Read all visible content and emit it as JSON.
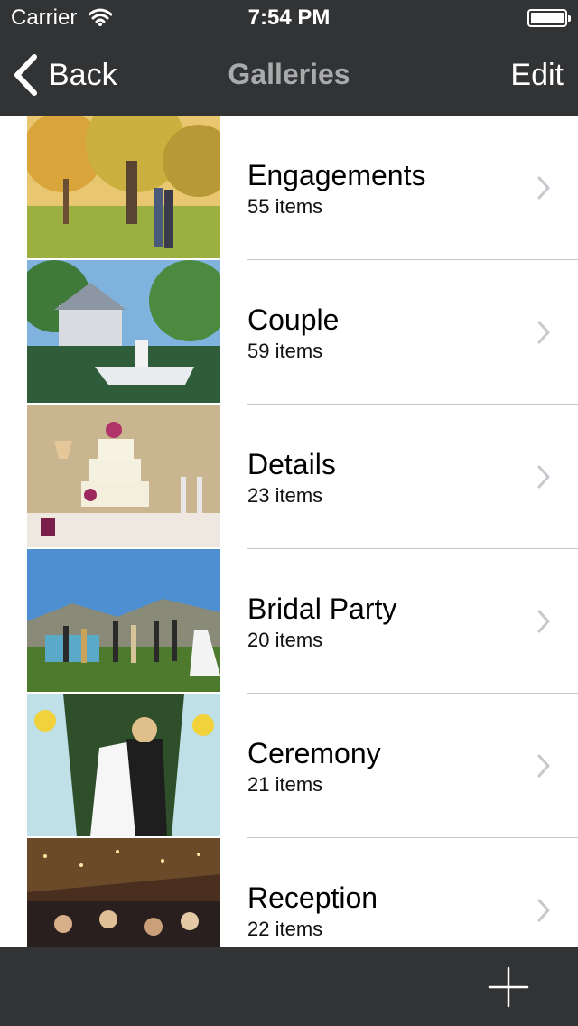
{
  "status_bar": {
    "carrier": "Carrier",
    "time": "7:54 PM"
  },
  "nav": {
    "back_label": "Back",
    "title": "Galleries",
    "edit_label": "Edit"
  },
  "galleries": [
    {
      "title": "Engagements",
      "count": "55 items"
    },
    {
      "title": "Couple",
      "count": "59 items"
    },
    {
      "title": "Details",
      "count": "23 items"
    },
    {
      "title": "Bridal Party",
      "count": "20 items"
    },
    {
      "title": "Ceremony",
      "count": "21 items"
    },
    {
      "title": "Reception",
      "count": "22 items"
    }
  ],
  "toolbar": {
    "add_icon": "plus-icon"
  },
  "colors": {
    "bar_background": "#323334",
    "title_gray": "#a9aaab",
    "separator": "#c8c7cc"
  }
}
